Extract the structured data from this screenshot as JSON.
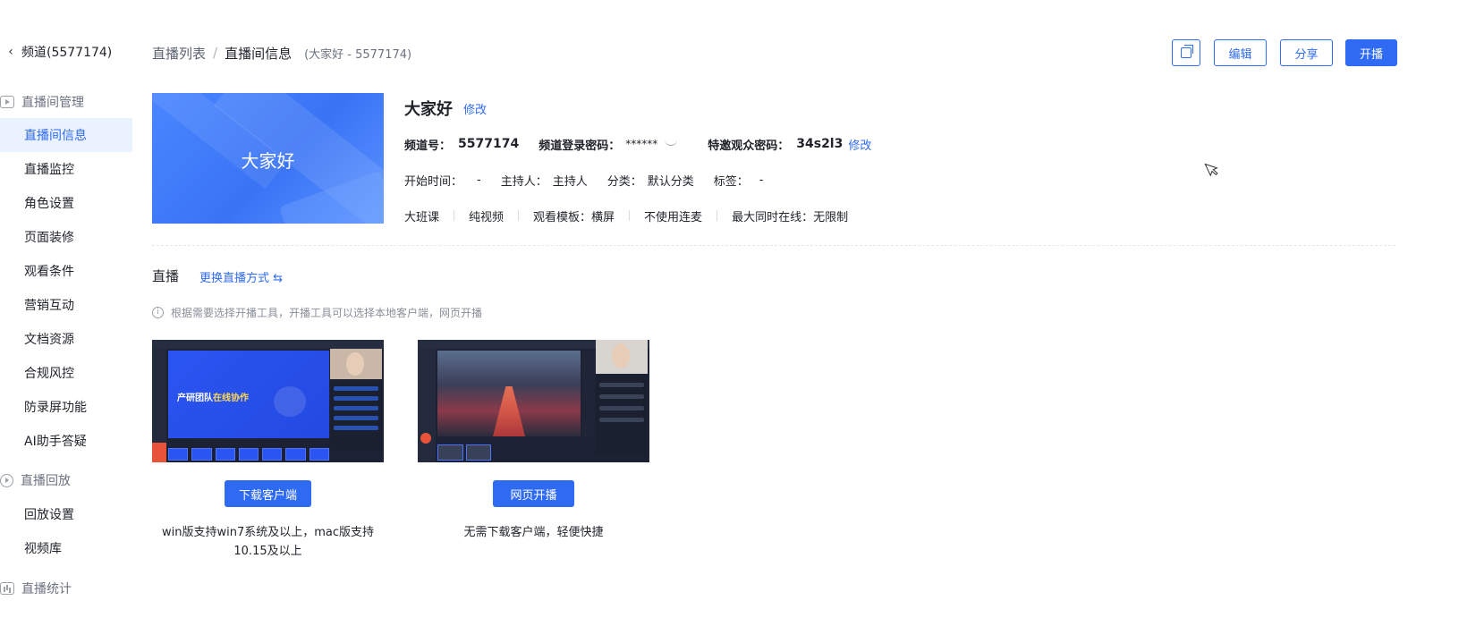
{
  "sidebar": {
    "channel_title": "频道(5577174)",
    "groups": {
      "room_manage": "直播间管理",
      "replay": "直播回放",
      "stats": "直播统计"
    },
    "items": [
      {
        "label": "直播间信息"
      },
      {
        "label": "直播监控"
      },
      {
        "label": "角色设置"
      },
      {
        "label": "页面装修"
      },
      {
        "label": "观看条件"
      },
      {
        "label": "营销互动"
      },
      {
        "label": "文档资源"
      },
      {
        "label": "合规风控"
      },
      {
        "label": "防录屏功能"
      },
      {
        "label": "AI助手答疑"
      }
    ],
    "replay_items": [
      {
        "label": "回放设置"
      },
      {
        "label": "视频库"
      }
    ]
  },
  "breadcrumb": {
    "list": "直播列表",
    "separator": "/",
    "current": "直播间信息",
    "sub": "(大家好 - 5577174)"
  },
  "header_buttons": {
    "edit": "编辑",
    "share": "分享",
    "start": "开播"
  },
  "room": {
    "cover_text": "大家好",
    "name": "大家好",
    "modify": "修改",
    "channel_label": "频道号：",
    "channel_no": "5577174",
    "login_pwd_label": "频道登录密码：",
    "login_pwd": "******",
    "guest_pwd_label": "特邀观众密码：",
    "guest_pwd": "34s2l3",
    "guest_modify": "修改",
    "start_label": "开始时间：",
    "start_value": "-",
    "host_label": "主持人：",
    "host_value": "主持人",
    "category_label": "分类：",
    "category_value": "默认分类",
    "tag_label": "标签：",
    "tag_value": "-",
    "tags": [
      "大班课",
      "纯视频",
      "观看模板：横屏",
      "不使用连麦",
      "最大同时在线：无限制"
    ]
  },
  "live": {
    "title": "直播",
    "switch": "更换直播方式 ⇆",
    "tip": "根据需要选择开播工具，开播工具可以选择本地客户端，网页开播",
    "client": {
      "slide_text_a": "产研团队",
      "slide_text_b": "在线协作",
      "button": "下载客户端",
      "desc_line1": "win版支持win7系统及以上，mac版支持",
      "desc_line2": "10.15及以上"
    },
    "web": {
      "button": "网页开播",
      "desc": "无需下载客户端，轻便快捷"
    }
  },
  "colors": {
    "accent": "#2f6bf2",
    "active_bg": "#eaf1ff"
  }
}
